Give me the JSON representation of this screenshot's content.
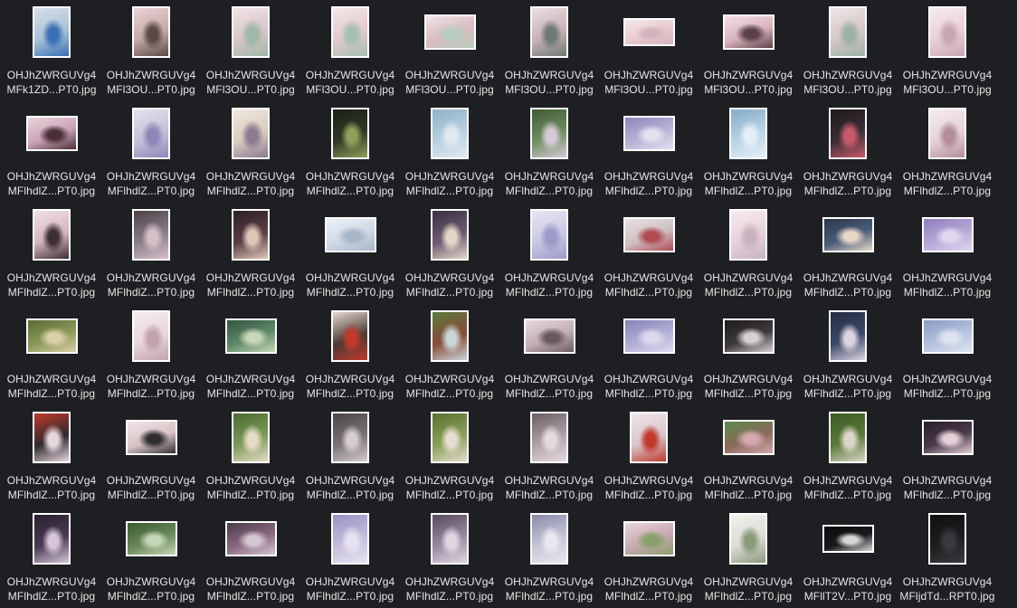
{
  "files": [
    {
      "line1": "OHJhZWRGUVg4",
      "line2": "MFk1ZD...PT0.jpg",
      "orientation": "portrait",
      "colors": [
        "#a9c2d6",
        "#3a6fb5",
        "#d8dde8"
      ]
    },
    {
      "line1": "OHJhZWRGUVg4",
      "line2": "MFl3OU...PT0.jpg",
      "orientation": "portrait",
      "colors": [
        "#c7a9a8",
        "#5a4a44",
        "#e8d2d4"
      ]
    },
    {
      "line1": "OHJhZWRGUVg4",
      "line2": "MFl3OU...PT0.jpg",
      "orientation": "portrait",
      "colors": [
        "#d9c4c9",
        "#9fb8a7",
        "#f0e4e6"
      ]
    },
    {
      "line1": "OHJhZWRGUVg4",
      "line2": "MFl3OU...PT0.jpg",
      "orientation": "portrait",
      "colors": [
        "#e3c9cc",
        "#a6c0b2",
        "#f3e7e9"
      ]
    },
    {
      "line1": "OHJhZWRGUVg4",
      "line2": "MFl3OU...PT0.jpg",
      "orientation": "landscape",
      "colors": [
        "#d8bcc2",
        "#b9cdbf",
        "#efe3e5"
      ]
    },
    {
      "line1": "OHJhZWRGUVg4",
      "line2": "MFl3OU...PT0.jpg",
      "orientation": "portrait",
      "colors": [
        "#c9b1b8",
        "#6e7a73",
        "#e9dde0"
      ]
    },
    {
      "line1": "OHJhZWRGUVg4",
      "line2": "MFl3OU...PT0.jpg",
      "orientation": "wide",
      "colors": [
        "#e8c9cf",
        "#d4b3bc",
        "#f5e9eb"
      ]
    },
    {
      "line1": "OHJhZWRGUVg4",
      "line2": "MFl3OU...PT0.jpg",
      "orientation": "landscape",
      "colors": [
        "#d9b3bd",
        "#5b4147",
        "#f0dfe3"
      ]
    },
    {
      "line1": "OHJhZWRGUVg4",
      "line2": "MFl3OU...PT0.jpg",
      "orientation": "portrait",
      "colors": [
        "#d6c6c8",
        "#9cb2a5",
        "#eee4e5"
      ]
    },
    {
      "line1": "OHJhZWRGUVg4",
      "line2": "MFl3OU...PT0.jpg",
      "orientation": "portrait",
      "colors": [
        "#e8d0d6",
        "#c9a7b2",
        "#f6eaec"
      ]
    },
    {
      "line1": "OHJhZWRGUVg4",
      "line2": "MFlhdlZ...PT0.jpg",
      "orientation": "landscape",
      "colors": [
        "#c9a3b4",
        "#4a2f3a",
        "#e9d4dc"
      ]
    },
    {
      "line1": "OHJhZWRGUVg4",
      "line2": "MFlhdlZ...PT0.jpg",
      "orientation": "portrait",
      "colors": [
        "#c5c0d8",
        "#8f86b8",
        "#e4e1ef"
      ]
    },
    {
      "line1": "OHJhZWRGUVg4",
      "line2": "MFlhdlZ...PT0.jpg",
      "orientation": "portrait",
      "colors": [
        "#d9cbbf",
        "#8c7a8f",
        "#efe7df"
      ]
    },
    {
      "line1": "OHJhZWRGUVg4",
      "line2": "MFlhdlZ...PT0.jpg",
      "orientation": "portrait",
      "colors": [
        "#2f3a26",
        "#8fa05b",
        "#1a2016"
      ]
    },
    {
      "line1": "OHJhZWRGUVg4",
      "line2": "MFlhdlZ...PT0.jpg",
      "orientation": "portrait",
      "colors": [
        "#b8d0e0",
        "#dfe9f0",
        "#8fb2c9"
      ]
    },
    {
      "line1": "OHJhZWRGUVg4",
      "line2": "MFlhdlZ...PT0.jpg",
      "orientation": "portrait",
      "colors": [
        "#6f8f5f",
        "#d7c9d8",
        "#3f5a35"
      ]
    },
    {
      "line1": "OHJhZWRGUVg4",
      "line2": "MFlhdlZ...PT0.jpg",
      "orientation": "landscape",
      "colors": [
        "#b9b2d6",
        "#e5e0f0",
        "#8e86bb"
      ]
    },
    {
      "line1": "OHJhZWRGUVg4",
      "line2": "MFlhdlZ...PT0.jpg",
      "orientation": "portrait",
      "colors": [
        "#b9d3e6",
        "#e4eef6",
        "#86abc8"
      ]
    },
    {
      "line1": "OHJhZWRGUVg4",
      "line2": "MFlhdlZ...PT0.jpg",
      "orientation": "portrait",
      "colors": [
        "#3a2f35",
        "#c75a6a",
        "#1e181b"
      ]
    },
    {
      "line1": "OHJhZWRGUVg4",
      "line2": "MFlhdlZ...PT0.jpg",
      "orientation": "portrait",
      "colors": [
        "#e6d3d8",
        "#b38e98",
        "#f4eaec"
      ]
    },
    {
      "line1": "OHJhZWRGUVg4",
      "line2": "MFlhdlZ...PT0.jpg",
      "orientation": "portrait",
      "colors": [
        "#d5b5bd",
        "#3d2e33",
        "#efe0e4"
      ]
    },
    {
      "line1": "OHJhZWRGUVg4",
      "line2": "MFlhdlZ...PT0.jpg",
      "orientation": "portrait",
      "colors": [
        "#8a7f86",
        "#d6bfc9",
        "#4b4248"
      ]
    },
    {
      "line1": "OHJhZWRGUVg4",
      "line2": "MFlhdlZ...PT0.jpg",
      "orientation": "portrait",
      "colors": [
        "#5a3e47",
        "#e0c8b8",
        "#2c1f24"
      ]
    },
    {
      "line1": "OHJhZWRGUVg4",
      "line2": "MFlhdlZ...PT0.jpg",
      "orientation": "landscape",
      "colors": [
        "#cfd8e6",
        "#a7b6c9",
        "#eef2f7"
      ]
    },
    {
      "line1": "OHJhZWRGUVg4",
      "line2": "MFlhdlZ...PT0.jpg",
      "orientation": "portrait",
      "colors": [
        "#6c5a72",
        "#e6d6c6",
        "#3c3141"
      ]
    },
    {
      "line1": "OHJhZWRGUVg4",
      "line2": "MFlhdlZ...PT0.jpg",
      "orientation": "portrait",
      "colors": [
        "#c9c8e3",
        "#9d9ac9",
        "#e7e6f3"
      ]
    },
    {
      "line1": "OHJhZWRGUVg4",
      "line2": "MFlhdlZ...PT0.jpg",
      "orientation": "landscape",
      "colors": [
        "#cdbfc2",
        "#b14a52",
        "#eae1e2"
      ]
    },
    {
      "line1": "OHJhZWRGUVg4",
      "line2": "MFlhdlZ...PT0.jpg",
      "orientation": "portrait",
      "colors": [
        "#e9d1da",
        "#c7b3c0",
        "#f6ecf0"
      ]
    },
    {
      "line1": "OHJhZWRGUVg4",
      "line2": "MFlhdlZ...PT0.jpg",
      "orientation": "landscape",
      "colors": [
        "#4a5d7a",
        "#e8d8c8",
        "#2b3648"
      ]
    },
    {
      "line1": "OHJhZWRGUVg4",
      "line2": "MFlhdlZ...PT0.jpg",
      "orientation": "landscape",
      "colors": [
        "#b7a8d6",
        "#e0d8ef",
        "#8e7fbf"
      ]
    },
    {
      "line1": "OHJhZWRGUVg4",
      "line2": "MFlhdlZ...PT0.jpg",
      "orientation": "landscape",
      "colors": [
        "#8c9a5a",
        "#d9cfa8",
        "#5a6a35"
      ]
    },
    {
      "line1": "OHJhZWRGUVg4",
      "line2": "MFlhdlZ...PT0.jpg",
      "orientation": "portrait",
      "colors": [
        "#e8d6dc",
        "#c2a3ad",
        "#f5ecef"
      ]
    },
    {
      "line1": "OHJhZWRGUVg4",
      "line2": "MFlhdlZ...PT0.jpg",
      "orientation": "landscape",
      "colors": [
        "#5f8a6a",
        "#c9d6b8",
        "#345440"
      ]
    },
    {
      "line1": "OHJhZWRGUVg4",
      "line2": "MFlhdlZ...PT0.jpg",
      "orientation": "portrait",
      "colors": [
        "#4a3b36",
        "#c0392b",
        "#e6d8d0"
      ]
    },
    {
      "line1": "OHJhZWRGUVg4",
      "line2": "MFlhdlZ...PT0.jpg",
      "orientation": "portrait",
      "colors": [
        "#8a4a3a",
        "#c9d6d8",
        "#5a7a3a"
      ]
    },
    {
      "line1": "OHJhZWRGUVg4",
      "line2": "MFlhdlZ...PT0.jpg",
      "orientation": "landscape",
      "colors": [
        "#c2aeb4",
        "#6a5a5e",
        "#e6dadd"
      ]
    },
    {
      "line1": "OHJhZWRGUVg4",
      "line2": "MFlhdlZ...PT0.jpg",
      "orientation": "landscape",
      "colors": [
        "#b3b0d6",
        "#dcd9ee",
        "#8682b8"
      ]
    },
    {
      "line1": "OHJhZWRGUVg4",
      "line2": "MFlhdlZ...PT0.jpg",
      "orientation": "landscape",
      "colors": [
        "#3e3a3c",
        "#d6d0d2",
        "#1e1b1c"
      ]
    },
    {
      "line1": "OHJhZWRGUVg4",
      "line2": "MFlhdlZ...PT0.jpg",
      "orientation": "portrait",
      "colors": [
        "#3c4a6a",
        "#dcd4e0",
        "#232b3e"
      ]
    },
    {
      "line1": "OHJhZWRGUVg4",
      "line2": "MFlhdlZ...PT0.jpg",
      "orientation": "landscape",
      "colors": [
        "#b6c2de",
        "#dde3f0",
        "#8a9bc4"
      ]
    },
    {
      "line1": "OHJhZWRGUVg4",
      "line2": "MFlhdlZ...PT0.jpg",
      "orientation": "portrait",
      "colors": [
        "#2e2a2e",
        "#e6d6de",
        "#c0392b"
      ]
    },
    {
      "line1": "OHJhZWRGUVg4",
      "line2": "MFlhdlZ...PT0.jpg",
      "orientation": "landscape",
      "colors": [
        "#d8c3c6",
        "#2e2e30",
        "#f0e6e8"
      ]
    },
    {
      "line1": "OHJhZWRGUVg4",
      "line2": "MFlhdlZ...PT0.jpg",
      "orientation": "portrait",
      "colors": [
        "#7d9a5a",
        "#e6dcc6",
        "#4a6a30"
      ]
    },
    {
      "line1": "OHJhZWRGUVg4",
      "line2": "MFlhdlZ...PT0.jpg",
      "orientation": "portrait",
      "colors": [
        "#7a7478",
        "#d6ccd2",
        "#4a4548"
      ]
    },
    {
      "line1": "OHJhZWRGUVg4",
      "line2": "MFlhdlZ...PT0.jpg",
      "orientation": "portrait",
      "colors": [
        "#8aa05a",
        "#e6dccf",
        "#5a7030"
      ]
    },
    {
      "line1": "OHJhZWRGUVg4",
      "line2": "MFlhdlZ...PT0.jpg",
      "orientation": "portrait",
      "colors": [
        "#b0a2a8",
        "#e6dae0",
        "#6a5e64"
      ]
    },
    {
      "line1": "OHJhZWRGUVg4",
      "line2": "MFlhdlZ...PT0.jpg",
      "orientation": "portrait",
      "colors": [
        "#d8c4cc",
        "#c0392b",
        "#f0e6ea"
      ]
    },
    {
      "line1": "OHJhZWRGUVg4",
      "line2": "MFlhdlZ...PT0.jpg",
      "orientation": "landscape",
      "colors": [
        "#8a6a5a",
        "#d6a8b0",
        "#5a8a4a"
      ]
    },
    {
      "line1": "OHJhZWRGUVg4",
      "line2": "MFlhdlZ...PT0.jpg",
      "orientation": "portrait",
      "colors": [
        "#5a7a3a",
        "#dcd6c8",
        "#3a5a22"
      ]
    },
    {
      "line1": "OHJhZWRGUVg4",
      "line2": "MFlhdlZ...PT0.jpg",
      "orientation": "landscape",
      "colors": [
        "#4a3a4a",
        "#e6d0d8",
        "#2a1e2a"
      ]
    },
    {
      "line1": "OHJhZWRGUVg4",
      "line2": "MFlhdlZ...PT0.jpg",
      "orientation": "portrait",
      "colors": [
        "#4a3a52",
        "#d6c6d8",
        "#2a2030"
      ]
    },
    {
      "line1": "OHJhZWRGUVg4",
      "line2": "MFlhdlZ...PT0.jpg",
      "orientation": "landscape",
      "colors": [
        "#6a8a5a",
        "#c6d6b8",
        "#3a5a30"
      ]
    },
    {
      "line1": "OHJhZWRGUVg4",
      "line2": "MFlhdlZ...PT0.jpg",
      "orientation": "landscape",
      "colors": [
        "#8a6a80",
        "#d6c6d2",
        "#4a3a48"
      ]
    },
    {
      "line1": "OHJhZWRGUVg4",
      "line2": "MFlhdlZ...PT0.jpg",
      "orientation": "portrait",
      "colors": [
        "#c6bedc",
        "#e6e2f0",
        "#9a90c4"
      ]
    },
    {
      "line1": "OHJhZWRGUVg4",
      "line2": "MFlhdlZ...PT0.jpg",
      "orientation": "portrait",
      "colors": [
        "#9a8aa0",
        "#e0d6e2",
        "#5a4a60"
      ]
    },
    {
      "line1": "OHJhZWRGUVg4",
      "line2": "MFlhdlZ...PT0.jpg",
      "orientation": "portrait",
      "colors": [
        "#c6c6d8",
        "#e8e8f0",
        "#8a8aa8"
      ]
    },
    {
      "line1": "OHJhZWRGUVg4",
      "line2": "MFlhdlZ...PT0.jpg",
      "orientation": "landscape",
      "colors": [
        "#c6a8b0",
        "#8aa06a",
        "#e6d6da"
      ]
    },
    {
      "line1": "OHJhZWRGUVg4",
      "line2": "MFlhdlZ...PT0.jpg",
      "orientation": "portrait",
      "colors": [
        "#dcdcd6",
        "#8a9a7a",
        "#f0f0ec"
      ]
    },
    {
      "line1": "OHJhZWRGUVg4",
      "line2": "MFllT2V...PT0.jpg",
      "orientation": "wide",
      "colors": [
        "#1a1a1c",
        "#d6d6d8",
        "#0a0a0c"
      ]
    },
    {
      "line1": "OHJhZWRGUVg4",
      "line2": "MFljdTd...RPT0.jpg",
      "orientation": "portrait",
      "colors": [
        "#1e1e20",
        "#3a3a3e",
        "#0e0e10"
      ]
    }
  ]
}
